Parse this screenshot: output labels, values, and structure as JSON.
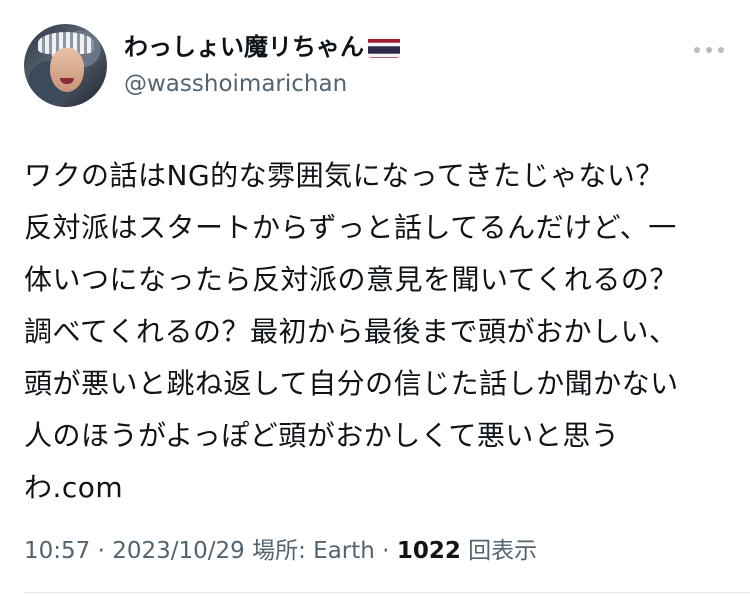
{
  "author": {
    "display_name": "わっしょい魔リちゃん",
    "handle": "@wasshoimarichan",
    "flag_icon": "thailand-flag-icon"
  },
  "tweet": {
    "lines": [
      "ワクの話はNG的な雰囲気になってきたじゃない？",
      "反対派はスタートからずっと話してるんだけど、一",
      "体いつになったら反対派の意見を聞いてくれるの？",
      "調べてくれるの？最初から最後まで頭がおかしい、",
      "頭が悪いと跳ね返して自分の信じた話しか聞かない",
      "人のほうがよっぽど頭がおかしくて悪いと思う",
      "わ.com"
    ]
  },
  "meta": {
    "time": "10:57",
    "separator": " · ",
    "date": "2023/10/29",
    "location_label": "場所: Earth",
    "views_count": "1022",
    "views_label": "回表示"
  },
  "colors": {
    "text": "#0f1419",
    "secondary": "#536471",
    "flag_red": "#a51931",
    "flag_white": "#f4f5f8",
    "flag_blue": "#2d2a4a"
  }
}
